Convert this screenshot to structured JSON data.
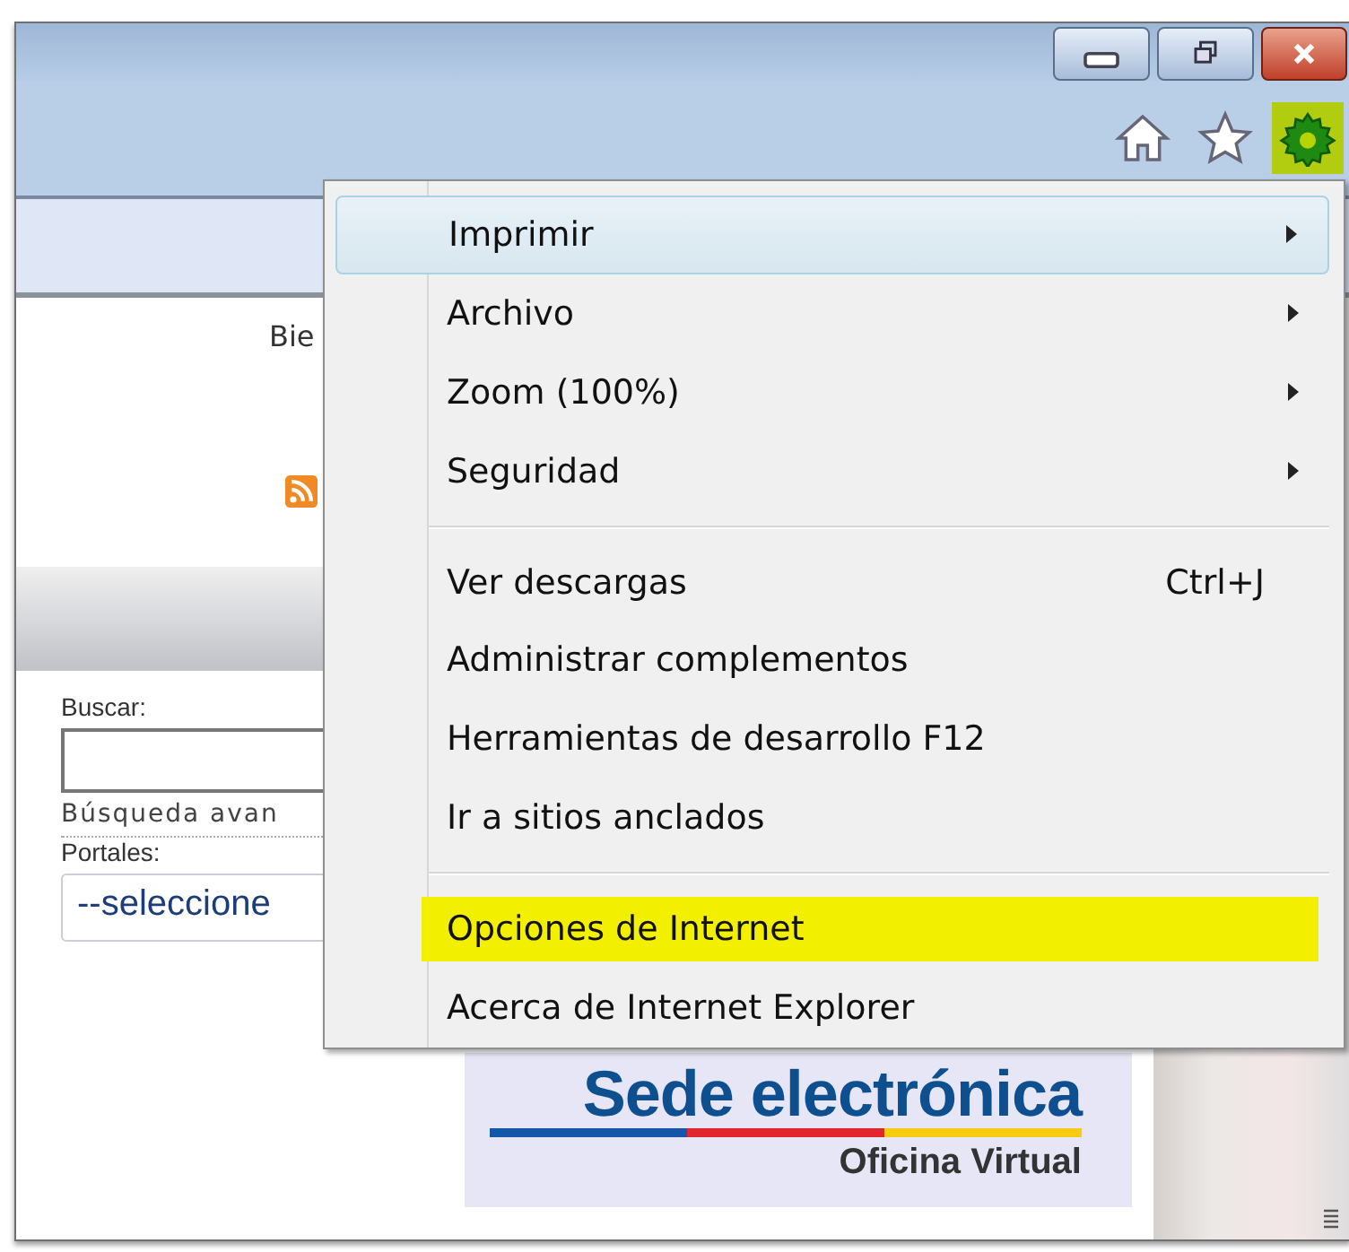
{
  "window": {
    "caption_buttons": [
      {
        "kind": "minimize"
      },
      {
        "kind": "restore"
      },
      {
        "kind": "close"
      }
    ]
  },
  "toolbar": [
    {
      "kind": "home",
      "selected": false
    },
    {
      "kind": "favorites",
      "selected": false
    },
    {
      "kind": "tools",
      "selected": true
    }
  ],
  "page": {
    "welcome": "Bie",
    "search_label": "Buscar:",
    "advanced_search": "Búsqueda avan",
    "portals_label": "Portales:",
    "portals_select": "--seleccione",
    "logo_title": "Sede electrónica",
    "logo_subtitle": "Oficina Virtual"
  },
  "menu": {
    "groups": [
      [
        {
          "label": "Imprimir",
          "submenu": true,
          "selected": true,
          "highlighted": false
        },
        {
          "label": "Archivo",
          "submenu": true,
          "selected": false,
          "highlighted": false
        },
        {
          "label": "Zoom (100%)",
          "submenu": true,
          "selected": false,
          "highlighted": false
        },
        {
          "label": "Seguridad",
          "submenu": true,
          "selected": false,
          "highlighted": false
        }
      ],
      [
        {
          "label": "Ver descargas",
          "shortcut": "Ctrl+J",
          "submenu": false,
          "selected": false,
          "highlighted": false
        },
        {
          "label": "Administrar complementos",
          "submenu": false,
          "selected": false,
          "highlighted": false
        },
        {
          "label": "Herramientas de desarrollo F12",
          "submenu": false,
          "selected": false,
          "highlighted": false
        },
        {
          "label": "Ir a sitios anclados",
          "submenu": false,
          "selected": false,
          "highlighted": false
        }
      ],
      [
        {
          "label": "Opciones de Internet",
          "submenu": false,
          "selected": false,
          "highlighted": true
        },
        {
          "label": "Acerca de Internet Explorer",
          "submenu": false,
          "selected": false,
          "highlighted": false
        }
      ]
    ]
  }
}
